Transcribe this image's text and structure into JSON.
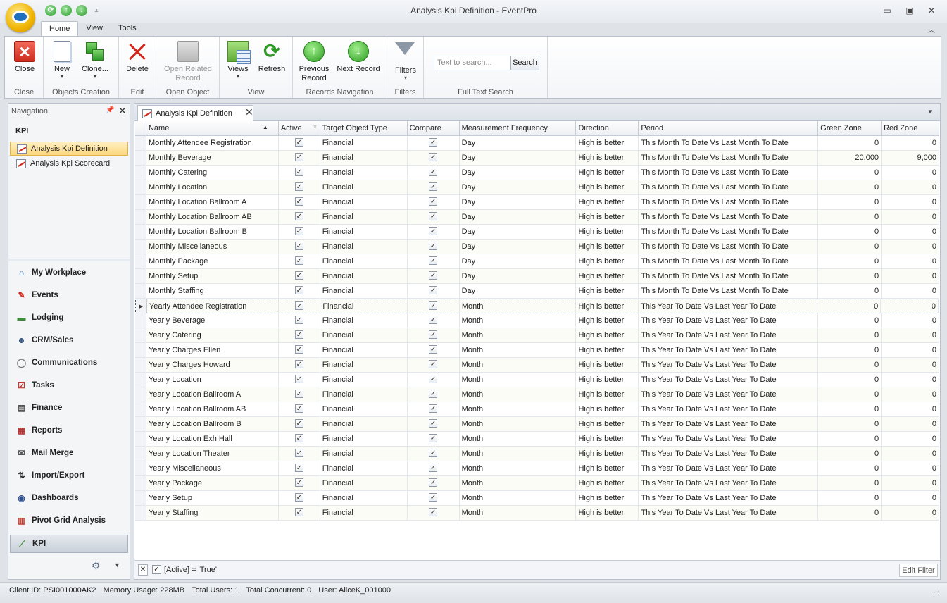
{
  "window": {
    "title": "Analysis Kpi Definition - EventPro",
    "minimize": "▭",
    "maximize": "▣",
    "close": "✕"
  },
  "quick_access": {
    "refresh": "⟳",
    "up": "↑",
    "down": "↓",
    "customize": "⩡"
  },
  "ribbon_tabs": [
    "Home",
    "View",
    "Tools"
  ],
  "ribbon": {
    "groups": {
      "close": "Close",
      "objects_creation": "Objects Creation",
      "edit": "Edit",
      "open_object": "Open Object",
      "view": "View",
      "records_navigation": "Records Navigation",
      "filters": "Filters",
      "full_text_search": "Full Text Search"
    },
    "buttons": {
      "close": "Close",
      "new": "New",
      "clone": "Clone...",
      "delete": "Delete",
      "open_related_line1": "Open Related",
      "open_related_line2": "Record",
      "views": "Views",
      "refresh": "Refresh",
      "previous_line1": "Previous",
      "previous_line2": "Record",
      "next": "Next Record",
      "filters": "Filters"
    },
    "search_placeholder": "Text to search...",
    "search_button": "Search"
  },
  "navigation": {
    "header": "Navigation",
    "section": "KPI",
    "items": [
      "Analysis Kpi Definition",
      "Analysis Kpi Scorecard"
    ],
    "modules": [
      {
        "label": "My Workplace",
        "icon": "house-icon"
      },
      {
        "label": "Events",
        "icon": "pushpin-icon"
      },
      {
        "label": "Lodging",
        "icon": "bed-icon"
      },
      {
        "label": "CRM/Sales",
        "icon": "people-icon"
      },
      {
        "label": "Communications",
        "icon": "speech-bubble-icon"
      },
      {
        "label": "Tasks",
        "icon": "clipboard-icon"
      },
      {
        "label": "Finance",
        "icon": "ledger-icon"
      },
      {
        "label": "Reports",
        "icon": "report-icon"
      },
      {
        "label": "Mail Merge",
        "icon": "envelope-icon"
      },
      {
        "label": "Import/Export",
        "icon": "arrows-icon"
      },
      {
        "label": "Dashboards",
        "icon": "gauge-icon"
      },
      {
        "label": "Pivot Grid Analysis",
        "icon": "pivot-icon"
      },
      {
        "label": "KPI",
        "icon": "kpi-chart-icon"
      }
    ]
  },
  "document_tab": {
    "label": "Analysis Kpi Definition"
  },
  "grid": {
    "columns": [
      "Name",
      "Active",
      "Target Object Type",
      "Compare",
      "Measurement Frequency",
      "Direction",
      "Period",
      "Green Zone",
      "Red Zone"
    ],
    "rows": [
      [
        "Monthly Attendee Registration",
        "Financial",
        "Day",
        "High is better",
        "This Month To Date Vs Last Month To Date",
        "0",
        "0"
      ],
      [
        "Monthly Beverage",
        "Financial",
        "Day",
        "High is better",
        "This Month To Date Vs Last Month To Date",
        "20,000",
        "9,000"
      ],
      [
        "Monthly Catering",
        "Financial",
        "Day",
        "High is better",
        "This Month To Date Vs Last Month To Date",
        "0",
        "0"
      ],
      [
        "Monthly Location",
        "Financial",
        "Day",
        "High is better",
        "This Month To Date Vs Last Month To Date",
        "0",
        "0"
      ],
      [
        "Monthly Location Ballroom A",
        "Financial",
        "Day",
        "High is better",
        "This Month To Date Vs Last Month To Date",
        "0",
        "0"
      ],
      [
        "Monthly Location Ballroom AB",
        "Financial",
        "Day",
        "High is better",
        "This Month To Date Vs Last Month To Date",
        "0",
        "0"
      ],
      [
        "Monthly Location Ballroom B",
        "Financial",
        "Day",
        "High is better",
        "This Month To Date Vs Last Month To Date",
        "0",
        "0"
      ],
      [
        "Monthly Miscellaneous",
        "Financial",
        "Day",
        "High is better",
        "This Month To Date Vs Last Month To Date",
        "0",
        "0"
      ],
      [
        "Monthly Package",
        "Financial",
        "Day",
        "High is better",
        "This Month To Date Vs Last Month To Date",
        "0",
        "0"
      ],
      [
        "Monthly Setup",
        "Financial",
        "Day",
        "High is better",
        "This Month To Date Vs Last Month To Date",
        "0",
        "0"
      ],
      [
        "Monthly Staffing",
        "Financial",
        "Day",
        "High is better",
        "This Month To Date Vs Last Month To Date",
        "0",
        "0"
      ],
      [
        "Yearly Attendee Registration",
        "Financial",
        "Month",
        "High is better",
        "This Year To Date Vs Last Year To Date",
        "0",
        "0"
      ],
      [
        "Yearly Beverage",
        "Financial",
        "Month",
        "High is better",
        "This Year To Date Vs Last Year To Date",
        "0",
        "0"
      ],
      [
        "Yearly Catering",
        "Financial",
        "Month",
        "High is better",
        "This Year To Date Vs Last Year To Date",
        "0",
        "0"
      ],
      [
        "Yearly Charges Ellen",
        "Financial",
        "Month",
        "High is better",
        "This Year To Date Vs Last Year To Date",
        "0",
        "0"
      ],
      [
        "Yearly Charges Howard",
        "Financial",
        "Month",
        "High is better",
        "This Year To Date Vs Last Year To Date",
        "0",
        "0"
      ],
      [
        "Yearly Location",
        "Financial",
        "Month",
        "High is better",
        "This Year To Date Vs Last Year To Date",
        "0",
        "0"
      ],
      [
        "Yearly Location Ballroom A",
        "Financial",
        "Month",
        "High is better",
        "This Year To Date Vs Last Year To Date",
        "0",
        "0"
      ],
      [
        "Yearly Location Ballroom AB",
        "Financial",
        "Month",
        "High is better",
        "This Year To Date Vs Last Year To Date",
        "0",
        "0"
      ],
      [
        "Yearly Location Ballroom B",
        "Financial",
        "Month",
        "High is better",
        "This Year To Date Vs Last Year To Date",
        "0",
        "0"
      ],
      [
        "Yearly Location Exh Hall",
        "Financial",
        "Month",
        "High is better",
        "This Year To Date Vs Last Year To Date",
        "0",
        "0"
      ],
      [
        "Yearly Location Theater",
        "Financial",
        "Month",
        "High is better",
        "This Year To Date Vs Last Year To Date",
        "0",
        "0"
      ],
      [
        "Yearly Miscellaneous",
        "Financial",
        "Month",
        "High is better",
        "This Year To Date Vs Last Year To Date",
        "0",
        "0"
      ],
      [
        "Yearly Package",
        "Financial",
        "Month",
        "High is better",
        "This Year To Date Vs Last Year To Date",
        "0",
        "0"
      ],
      [
        "Yearly Setup",
        "Financial",
        "Month",
        "High is better",
        "This Year To Date Vs Last Year To Date",
        "0",
        "0"
      ],
      [
        "Yearly Staffing",
        "Financial",
        "Month",
        "High is better",
        "This Year To Date Vs Last Year To Date",
        "0",
        "0"
      ]
    ],
    "active_checked": true,
    "compare_checked": true
  },
  "filter_bar": {
    "text": "[Active] = 'True'",
    "edit_button": "Edit Filter"
  },
  "status_bar": {
    "client_id": "Client ID: PSI001000AK2",
    "memory": "Memory Usage: 228MB",
    "total_users": "Total Users: 1",
    "total_concurrent": "Total Concurrent: 0",
    "user": "User: AliceK_001000"
  }
}
